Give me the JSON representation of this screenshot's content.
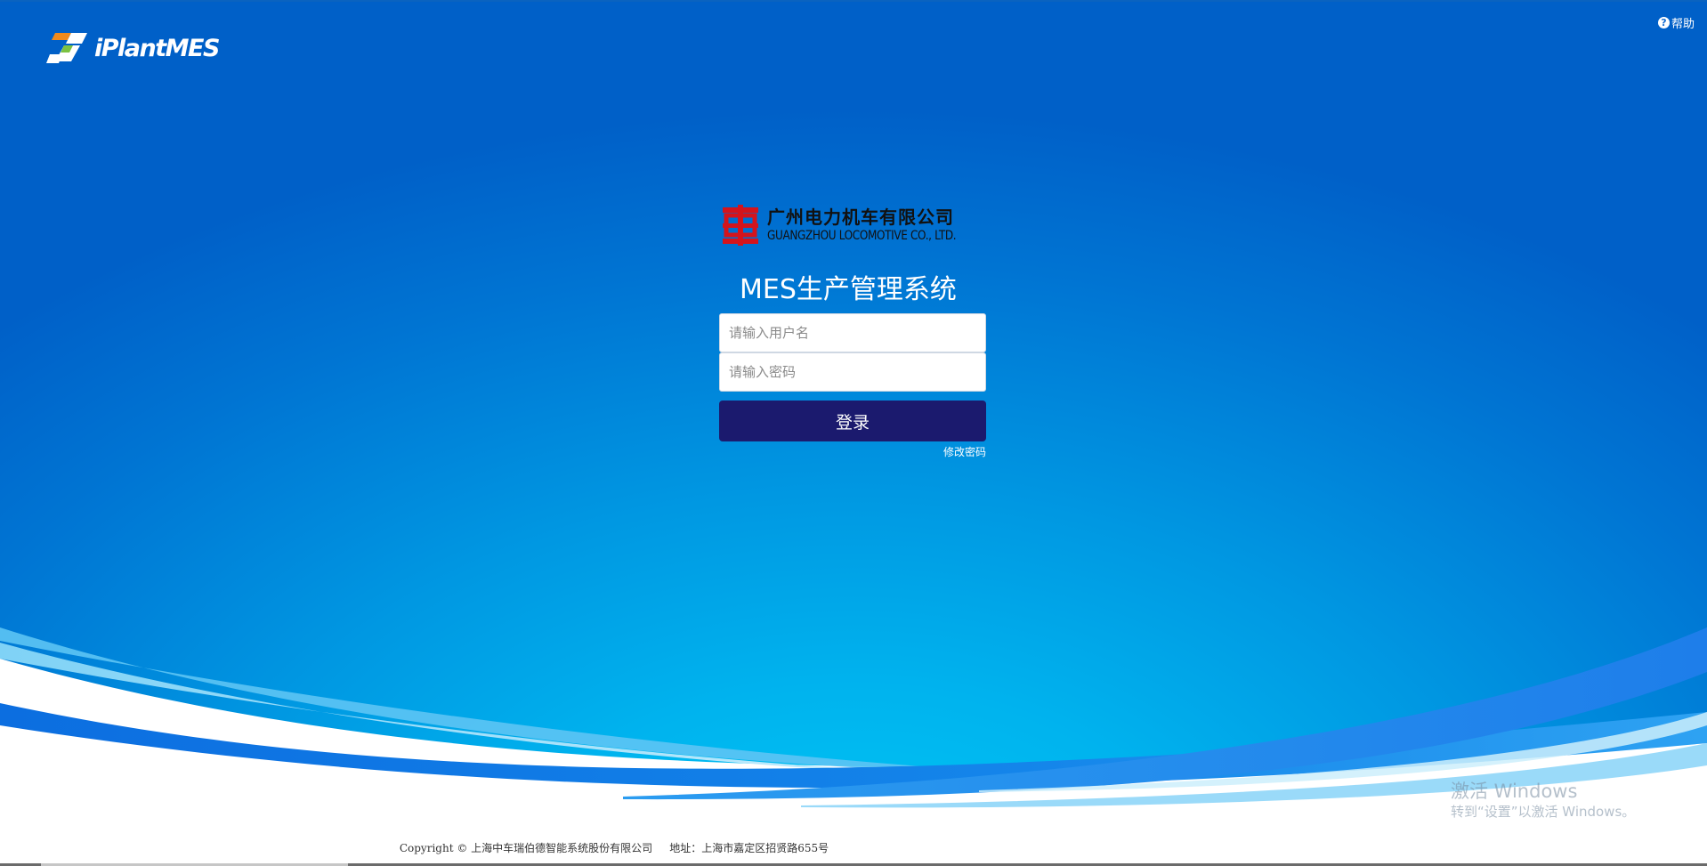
{
  "brand": {
    "name": "iPlantMES"
  },
  "header": {
    "help_label": "帮助",
    "help_icon": "question-circle-icon"
  },
  "company": {
    "name_cn": "广州电力机车有限公司",
    "name_en": "GUANGZHOU LOCOMOTIVE CO., LTD.",
    "logo_color": "#d4141c"
  },
  "login": {
    "title": "MES生产管理系统",
    "username_placeholder": "请输入用户名",
    "username_value": "",
    "password_placeholder": "请输入密码",
    "password_value": "",
    "submit_label": "登录",
    "change_password_label": "修改密码"
  },
  "watermark": {
    "title": "激活 Windows",
    "subtitle": "转到“设置”以激活 Windows。"
  },
  "footer": {
    "text": "Copyright © 上海中车瑞伯德智能系统股份有限公司     地址：上海市嘉定区招贤路655号"
  },
  "colors": {
    "background_top": "#0060c8",
    "background_center": "#00c9f5",
    "button": "#1b1a6e",
    "text_light": "#ffffff"
  }
}
